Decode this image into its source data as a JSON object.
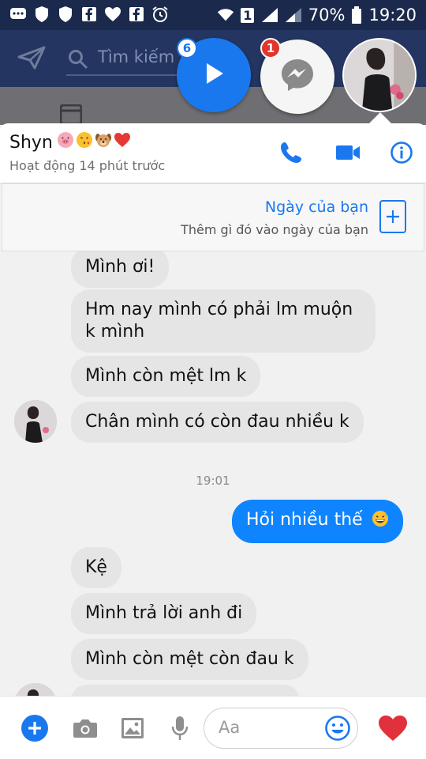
{
  "status_bar": {
    "battery_percent": "70%",
    "time": "19:20",
    "sim_label": "1"
  },
  "facebook_bar": {
    "search_placeholder": "Tìm kiếm"
  },
  "chat_heads": [
    {
      "icon": "play-icon",
      "badge": "6"
    },
    {
      "icon": "messenger-icon",
      "badge": "1"
    },
    {
      "icon": "avatar"
    }
  ],
  "conversation": {
    "name": "Shyn",
    "name_emoji": [
      "pig-face-emoji",
      "kissing-face-emoji",
      "dog-face-emoji",
      "red-heart-emoji"
    ],
    "status": "Hoạt động 14 phút trước",
    "actions": [
      "phone-icon",
      "video-camera-icon",
      "info-icon"
    ]
  },
  "day_banner": {
    "title": "Ngày của bạn",
    "subtitle": "Thêm gì đó vào ngày của bạn"
  },
  "messages": [
    {
      "dir": "in",
      "text": "Mình ơi!"
    },
    {
      "dir": "in",
      "text": "Hm nay mình có phải lm muộn k mình"
    },
    {
      "dir": "in",
      "text": "Mình còn mệt lm k"
    },
    {
      "dir": "in",
      "text": "Chân mình có còn đau nhiều k"
    },
    {
      "type": "time",
      "text": "19:01"
    },
    {
      "dir": "out",
      "text": "Hỏi nhiều thế"
    },
    {
      "dir": "in",
      "text": "Kệ"
    },
    {
      "dir": "in",
      "text": "Mình trả lời anh đi"
    },
    {
      "dir": "in",
      "text": "Mình còn mệt còn đau k"
    }
  ],
  "composer": {
    "placeholder": "Aa",
    "icons": [
      "add-icon",
      "camera-icon",
      "image-icon",
      "microphone-icon",
      "emoji-icon",
      "heart-icon"
    ]
  },
  "colors": {
    "accent": "#1a78ef",
    "outgoing_bubble": "#0f84ff",
    "incoming_bubble": "#e5e5e5",
    "status_bar": "#1b2a4c",
    "like_heart": "#e0313c",
    "badge": "#e0362c"
  }
}
